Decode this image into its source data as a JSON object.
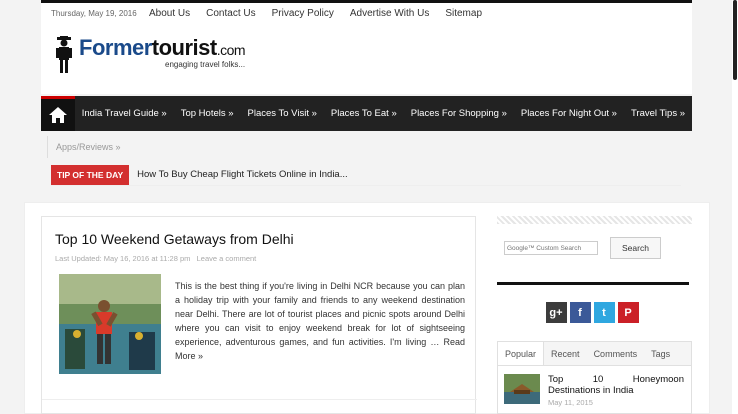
{
  "topbar": {
    "date": "Thursday, May 19, 2016",
    "links": [
      "About Us",
      "Contact Us",
      "Privacy Policy",
      "Advertise With Us",
      "Sitemap"
    ]
  },
  "logo": {
    "name_part1": "Former",
    "name_part2": "tourist",
    "name_part3": ".com",
    "tagline": "engaging travel folks..."
  },
  "nav": {
    "home_icon": "home-icon",
    "items": [
      "India Travel Guide »",
      "Top Hotels »",
      "Places To Visit »",
      "Places To Eat »",
      "Places For Shopping »",
      "Places For Night Out »",
      "Travel Tips »"
    ],
    "sub_item": "Apps/Reviews »"
  },
  "tip": {
    "label": "TIP OF THE DAY",
    "text": "How To Buy Cheap Flight Tickets Online in India..."
  },
  "post": {
    "title": "Top 10 Weekend Getaways from Delhi",
    "meta_updated": "Last Updated: May 16, 2016 at 11:28 pm",
    "meta_comment": "Leave a comment",
    "excerpt": "This is the best thing if you're living in Delhi NCR because you can plan a holiday trip with your family and friends to any weekend destination near Delhi. There are lot of tourist places and picnic spots around Delhi where you can visit to enjoy weekend break for lot of sightseeing experience, adventurous games, and fun activities. I'm living … ",
    "read_more": "Read More »"
  },
  "sidebar": {
    "search_placeholder": "Google™ Custom Search",
    "search_button": "Search",
    "social": [
      {
        "icon": "google-plus-icon",
        "glyph": "g+",
        "color": "#3c3c3c"
      },
      {
        "icon": "facebook-icon",
        "glyph": "f",
        "color": "#3b5998"
      },
      {
        "icon": "twitter-icon",
        "glyph": "t",
        "color": "#2fa7e0"
      },
      {
        "icon": "pinterest-icon",
        "glyph": "P",
        "color": "#cb2027"
      }
    ],
    "tabs": [
      "Popular",
      "Recent",
      "Comments",
      "Tags"
    ],
    "active_tab": "Popular",
    "popular_item": {
      "title": "Top 10 Honeymoon Destinations in India",
      "date": "May 11, 2015"
    }
  },
  "colors": {
    "nav_bg": "#222222",
    "accent_red": "#d32f2f",
    "logo_blue": "#1a4a8a"
  }
}
